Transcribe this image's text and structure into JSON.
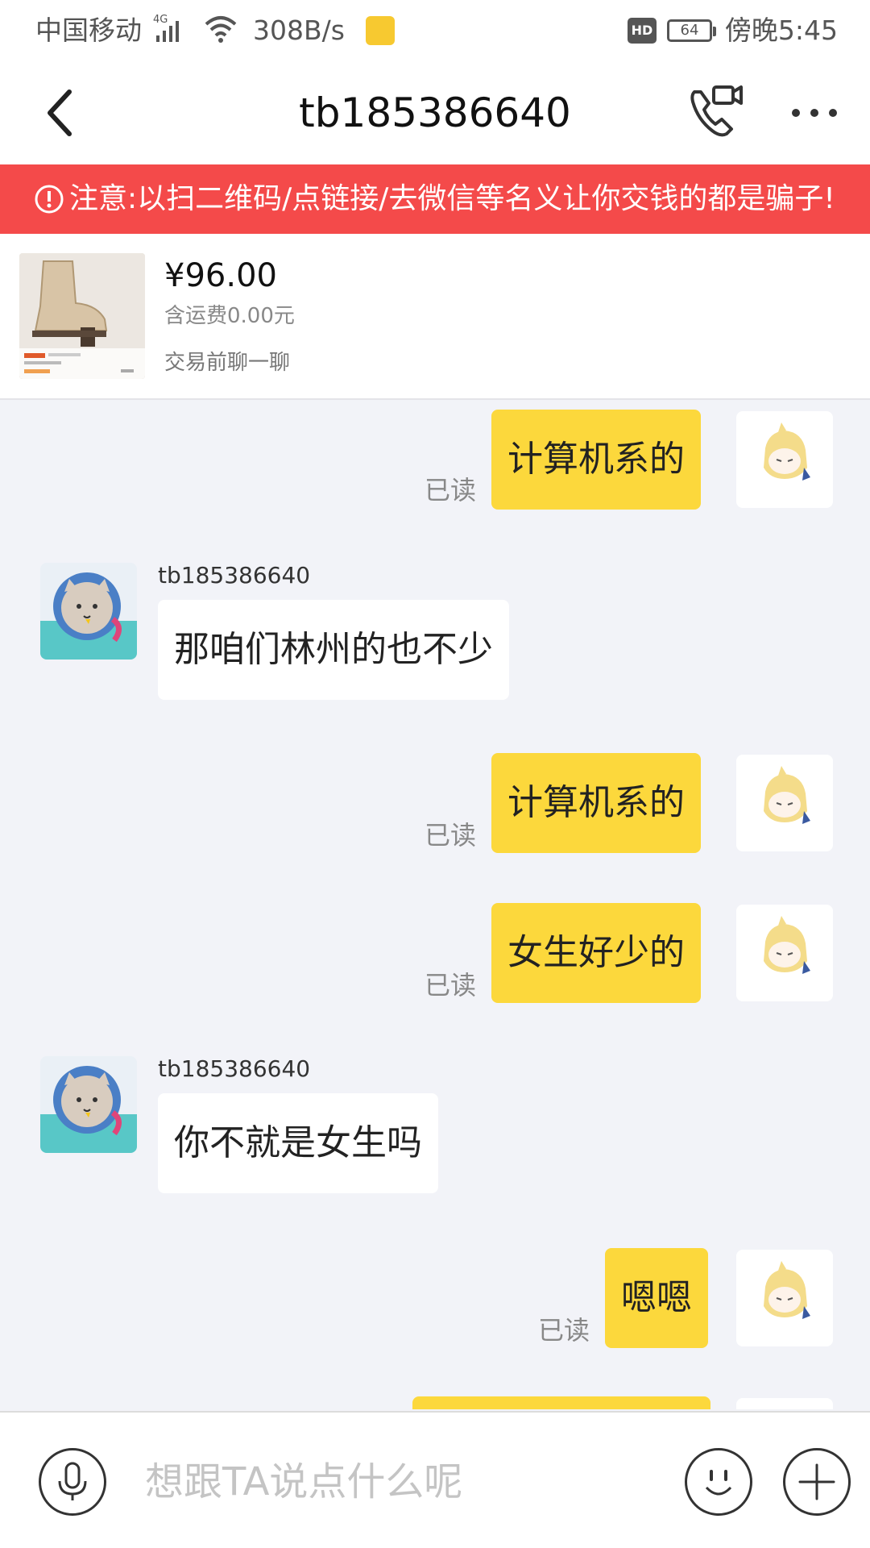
{
  "status_bar": {
    "carrier": "中国移动",
    "network": "4G",
    "speed": "308B/s",
    "hd_badge": "HD",
    "battery": "64",
    "time": "傍晚5:45"
  },
  "header": {
    "title": "tb185386640",
    "back_icon": "chevron-left-icon",
    "call_icon": "phone-video-icon",
    "more_icon": "more-dots-icon"
  },
  "warning": {
    "text": "注意:以扫二维码/点链接/去微信等名义让你交钱的都是骗子!"
  },
  "product": {
    "price": "¥96.00",
    "shipping": "含运费0.00元",
    "chat_label": "交易前聊一聊"
  },
  "messages": [
    {
      "direction": "out",
      "text": "计算机系的",
      "status": "已读"
    },
    {
      "direction": "in",
      "sender": "tb185386640",
      "text": "那咱们林州的也不少"
    },
    {
      "direction": "out",
      "text": "计算机系的",
      "status": "已读"
    },
    {
      "direction": "out",
      "text": "女生好少的",
      "status": "已读"
    },
    {
      "direction": "in",
      "sender": "tb185386640",
      "text": "你不就是女生吗"
    },
    {
      "direction": "out",
      "text": "嗯嗯",
      "status": "已读"
    }
  ],
  "input_bar": {
    "placeholder": "想跟TA说点什么呢"
  },
  "colors": {
    "warning_bg": "#f44a4a",
    "outgoing_bubble": "#fcd83c",
    "incoming_bubble": "#ffffff",
    "chat_bg": "#f2f3f8"
  }
}
